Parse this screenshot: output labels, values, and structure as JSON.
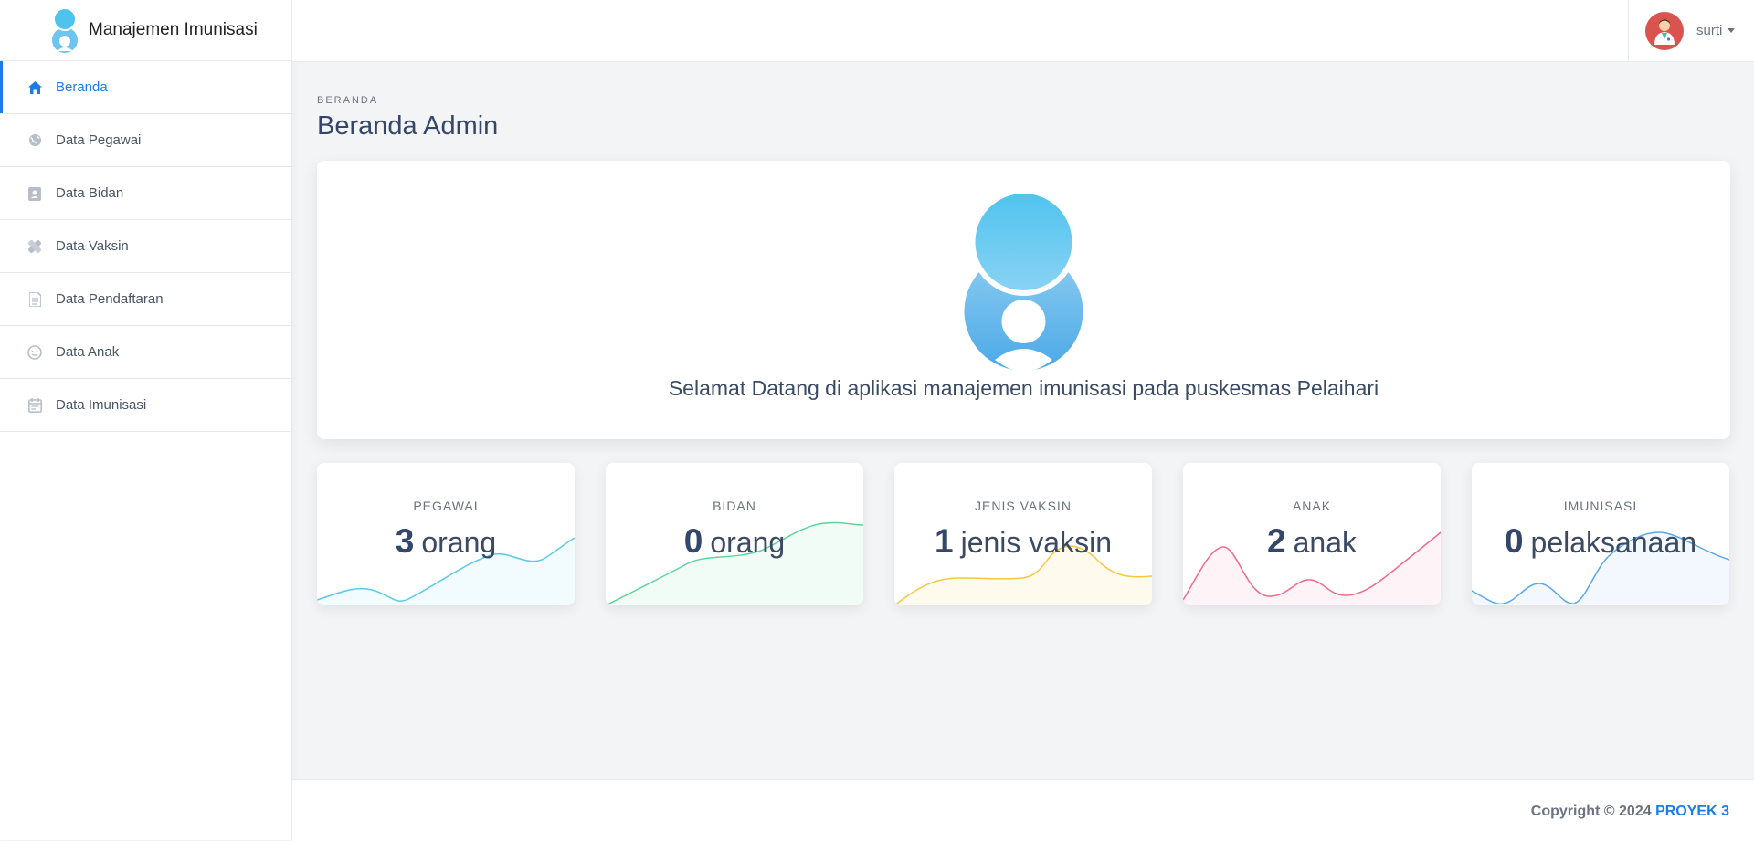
{
  "app": {
    "title": "Manajemen Imunisasi"
  },
  "sidebar": {
    "items": [
      {
        "label": "Beranda",
        "icon": "home-icon",
        "active": true
      },
      {
        "label": "Data Pegawai",
        "icon": "globe-icon"
      },
      {
        "label": "Data Bidan",
        "icon": "id-badge-icon"
      },
      {
        "label": "Data Vaksin",
        "icon": "bandage-icon"
      },
      {
        "label": "Data Pendaftaran",
        "icon": "document-icon"
      },
      {
        "label": "Data Anak",
        "icon": "baby-face-icon"
      },
      {
        "label": "Data Imunisasi",
        "icon": "calendar-icon"
      }
    ]
  },
  "header": {
    "user": "surti"
  },
  "main": {
    "breadcrumb": "BERANDA",
    "title": "Beranda Admin",
    "welcome": "Selamat Datang di aplikasi manajemen imunisasi pada puskesmas Pelaihari"
  },
  "stats": [
    {
      "label": "PEGAWAI",
      "value": "3",
      "unit": "orang",
      "color": "#5ac8e8"
    },
    {
      "label": "BIDAN",
      "value": "0",
      "unit": "orang",
      "color": "#5fd49a"
    },
    {
      "label": "JENIS VAKSIN",
      "value": "1",
      "unit": "jenis vaksin",
      "color": "#f5c842"
    },
    {
      "label": "ANAK",
      "value": "2",
      "unit": "anak",
      "color": "#f16a8a"
    },
    {
      "label": "IMUNISASI",
      "value": "0",
      "unit": "pelaksanaan",
      "color": "#5aa7ea"
    }
  ],
  "footer": {
    "copyright": "Copyright © 2024",
    "project": "PROYEK 3"
  },
  "colors": {
    "accent": "#1b7ce8",
    "logo": "#4fc3ee"
  }
}
